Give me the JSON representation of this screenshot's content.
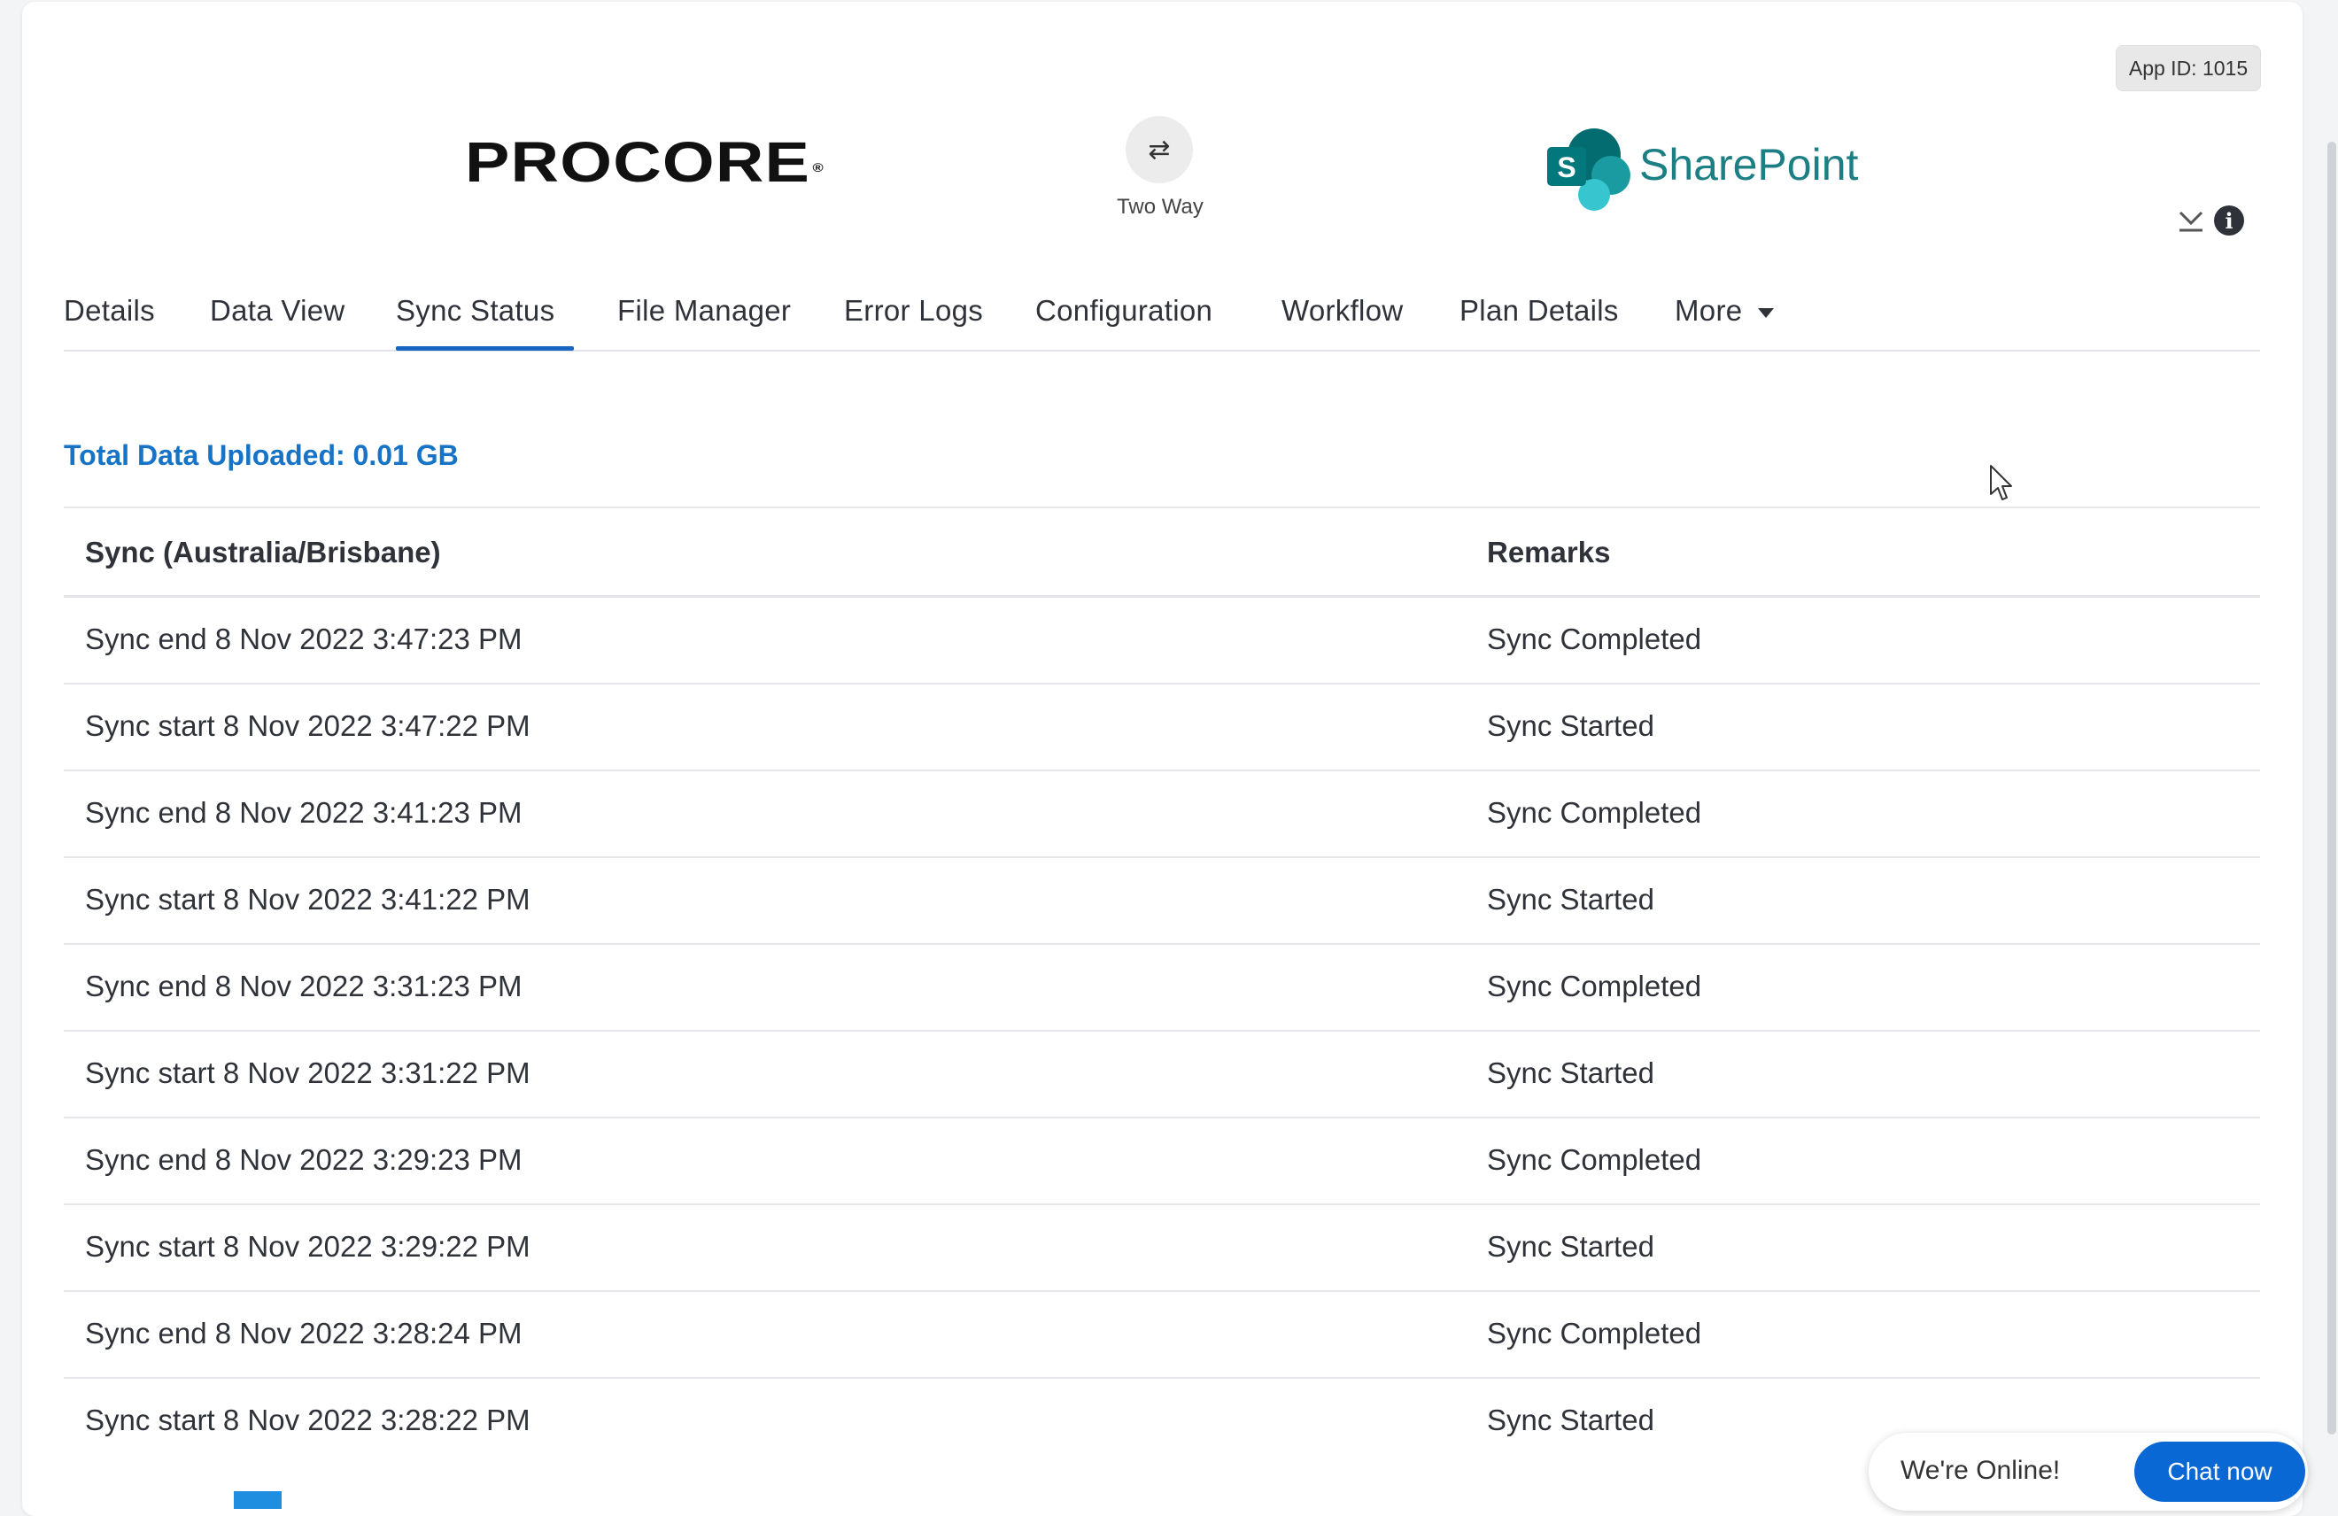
{
  "header": {
    "app_id": "App ID: 1015",
    "source_app": "PROCORE",
    "sync_direction": "Two Way",
    "target_app": "SharePoint",
    "sharepoint_letter": "S"
  },
  "tabs": [
    {
      "label": "Details"
    },
    {
      "label": "Data View"
    },
    {
      "label": "Sync Status"
    },
    {
      "label": "File Manager"
    },
    {
      "label": "Error Logs"
    },
    {
      "label": "Configuration"
    },
    {
      "label": "Workflow"
    },
    {
      "label": "Plan Details"
    },
    {
      "label": "More"
    }
  ],
  "active_tab": "Sync Status",
  "summary": {
    "total_uploaded": "Total Data Uploaded: 0.01 GB"
  },
  "table": {
    "columns": [
      "Sync (Australia/Brisbane)",
      "Remarks"
    ],
    "rows": [
      {
        "sync": "Sync end 8 Nov 2022 3:47:23 PM",
        "remarks": "Sync Completed"
      },
      {
        "sync": "Sync start 8 Nov 2022 3:47:22 PM",
        "remarks": "Sync Started"
      },
      {
        "sync": "Sync end 8 Nov 2022 3:41:23 PM",
        "remarks": "Sync Completed"
      },
      {
        "sync": "Sync start 8 Nov 2022 3:41:22 PM",
        "remarks": "Sync Started"
      },
      {
        "sync": "Sync end 8 Nov 2022 3:31:23 PM",
        "remarks": "Sync Completed"
      },
      {
        "sync": "Sync start 8 Nov 2022 3:31:22 PM",
        "remarks": "Sync Started"
      },
      {
        "sync": "Sync end 8 Nov 2022 3:29:23 PM",
        "remarks": "Sync Completed"
      },
      {
        "sync": "Sync start 8 Nov 2022 3:29:22 PM",
        "remarks": "Sync Started"
      },
      {
        "sync": "Sync end 8 Nov 2022 3:28:24 PM",
        "remarks": "Sync Completed"
      },
      {
        "sync": "Sync start 8 Nov 2022 3:28:22 PM",
        "remarks": "Sync Started"
      }
    ]
  },
  "chat": {
    "status": "We're Online!",
    "button": "Chat now"
  },
  "colors": {
    "accent": "#1766c2",
    "total_text": "#1673c6",
    "sharepoint": "#1c7f83",
    "chat_button": "#0a68d4"
  }
}
